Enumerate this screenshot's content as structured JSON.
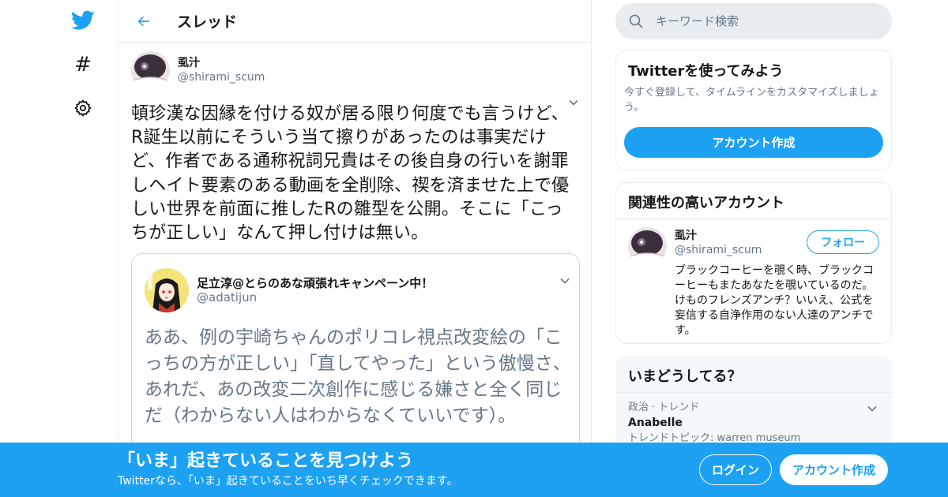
{
  "colors": {
    "accent": "#1da1f2",
    "text": "#14171a",
    "secondary": "#657786",
    "border": "#e6ecf0"
  },
  "nav": {
    "items": [
      {
        "icon": "twitter-bird-icon"
      },
      {
        "icon": "hashtag-icon",
        "glyph": "#"
      },
      {
        "icon": "gear-icon"
      }
    ]
  },
  "header": {
    "title": "スレッド",
    "back_icon": "back-arrow-icon"
  },
  "tweet": {
    "author_name": "虱汁",
    "author_handle": "@shirami_scum",
    "text": "頓珍漢な因縁を付ける奴が居る限り何度でも言うけど、R誕生以前にそういう当て擦りがあったのは事実だけど、作者である通称祝詞兄貴はその後自身の行いを謝罪しヘイト要素のある動画を全削除、禊を済ませた上で優しい世界を前面に推したRの雛型を公開。そこに「こっちが正しい」なんて押し付けは無い。",
    "quote": {
      "author_name": "足立淳@とらのあな頑張れキャンペーン中！",
      "author_handle": "@adatijun",
      "text": "ああ、例の宇崎ちゃんのポリコレ視点改変絵の「こっちの方が正しい」「直してやった」という傲慢さ、あれだ、あの改変二次創作に感じる嫌さと全く同じだ（わからない人はわからなくていいです）。"
    }
  },
  "search": {
    "placeholder": "キーワード検索"
  },
  "try_card": {
    "title": "Twitterを使ってみよう",
    "description": "今すぐ登録して、タイムラインをカスタマイズしましょう。",
    "button": "アカウント作成"
  },
  "related": {
    "title": "関連性の高いアカウント",
    "account": {
      "name": "虱汁",
      "handle": "@shirami_scum",
      "follow_button": "フォロー",
      "bio": "ブラックコーヒーを覗く時、ブラックコーヒーもまたあなたを覗いているのだ。 けものフレンズアンチ？いいえ、公式を妄信する自浄作用のない人達のアンチです。"
    }
  },
  "trends": {
    "title": "いまどうしてる？",
    "items": [
      {
        "meta": "政治 · トレンド",
        "name": "Anabelle",
        "topic": "トレンドトピック: warren museum"
      }
    ]
  },
  "banner": {
    "title": "「いま」起きていることを見つけよう",
    "subtitle": "Twitterなら、「いま」起きていることをいち早くチェックできます。",
    "login": "ログイン",
    "signup": "アカウント作成"
  }
}
